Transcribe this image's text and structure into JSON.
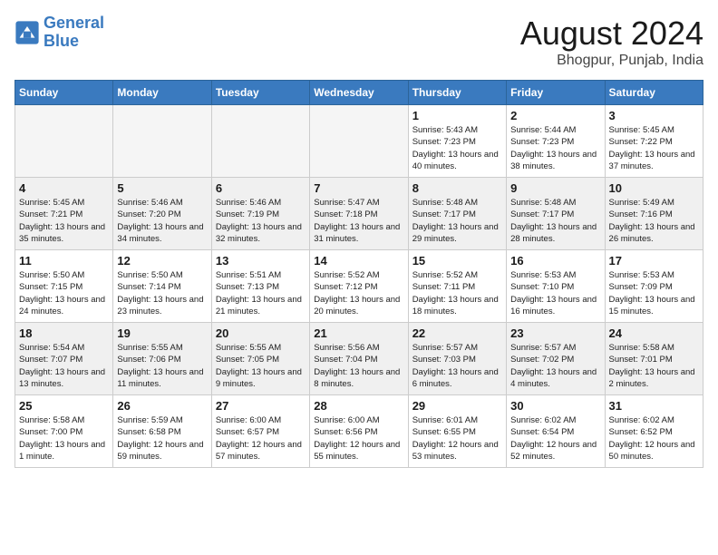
{
  "header": {
    "logo_line1": "General",
    "logo_line2": "Blue",
    "month_title": "August 2024",
    "location": "Bhogpur, Punjab, India"
  },
  "weekdays": [
    "Sunday",
    "Monday",
    "Tuesday",
    "Wednesday",
    "Thursday",
    "Friday",
    "Saturday"
  ],
  "weeks": [
    [
      {
        "day": "",
        "empty": true
      },
      {
        "day": "",
        "empty": true
      },
      {
        "day": "",
        "empty": true
      },
      {
        "day": "",
        "empty": true
      },
      {
        "day": "1",
        "sunrise": "5:43 AM",
        "sunset": "7:23 PM",
        "daylight": "13 hours and 40 minutes."
      },
      {
        "day": "2",
        "sunrise": "5:44 AM",
        "sunset": "7:23 PM",
        "daylight": "13 hours and 38 minutes."
      },
      {
        "day": "3",
        "sunrise": "5:45 AM",
        "sunset": "7:22 PM",
        "daylight": "13 hours and 37 minutes."
      }
    ],
    [
      {
        "day": "4",
        "sunrise": "5:45 AM",
        "sunset": "7:21 PM",
        "daylight": "13 hours and 35 minutes."
      },
      {
        "day": "5",
        "sunrise": "5:46 AM",
        "sunset": "7:20 PM",
        "daylight": "13 hours and 34 minutes."
      },
      {
        "day": "6",
        "sunrise": "5:46 AM",
        "sunset": "7:19 PM",
        "daylight": "13 hours and 32 minutes."
      },
      {
        "day": "7",
        "sunrise": "5:47 AM",
        "sunset": "7:18 PM",
        "daylight": "13 hours and 31 minutes."
      },
      {
        "day": "8",
        "sunrise": "5:48 AM",
        "sunset": "7:17 PM",
        "daylight": "13 hours and 29 minutes."
      },
      {
        "day": "9",
        "sunrise": "5:48 AM",
        "sunset": "7:17 PM",
        "daylight": "13 hours and 28 minutes."
      },
      {
        "day": "10",
        "sunrise": "5:49 AM",
        "sunset": "7:16 PM",
        "daylight": "13 hours and 26 minutes."
      }
    ],
    [
      {
        "day": "11",
        "sunrise": "5:50 AM",
        "sunset": "7:15 PM",
        "daylight": "13 hours and 24 minutes."
      },
      {
        "day": "12",
        "sunrise": "5:50 AM",
        "sunset": "7:14 PM",
        "daylight": "13 hours and 23 minutes."
      },
      {
        "day": "13",
        "sunrise": "5:51 AM",
        "sunset": "7:13 PM",
        "daylight": "13 hours and 21 minutes."
      },
      {
        "day": "14",
        "sunrise": "5:52 AM",
        "sunset": "7:12 PM",
        "daylight": "13 hours and 20 minutes."
      },
      {
        "day": "15",
        "sunrise": "5:52 AM",
        "sunset": "7:11 PM",
        "daylight": "13 hours and 18 minutes."
      },
      {
        "day": "16",
        "sunrise": "5:53 AM",
        "sunset": "7:10 PM",
        "daylight": "13 hours and 16 minutes."
      },
      {
        "day": "17",
        "sunrise": "5:53 AM",
        "sunset": "7:09 PM",
        "daylight": "13 hours and 15 minutes."
      }
    ],
    [
      {
        "day": "18",
        "sunrise": "5:54 AM",
        "sunset": "7:07 PM",
        "daylight": "13 hours and 13 minutes."
      },
      {
        "day": "19",
        "sunrise": "5:55 AM",
        "sunset": "7:06 PM",
        "daylight": "13 hours and 11 minutes."
      },
      {
        "day": "20",
        "sunrise": "5:55 AM",
        "sunset": "7:05 PM",
        "daylight": "13 hours and 9 minutes."
      },
      {
        "day": "21",
        "sunrise": "5:56 AM",
        "sunset": "7:04 PM",
        "daylight": "13 hours and 8 minutes."
      },
      {
        "day": "22",
        "sunrise": "5:57 AM",
        "sunset": "7:03 PM",
        "daylight": "13 hours and 6 minutes."
      },
      {
        "day": "23",
        "sunrise": "5:57 AM",
        "sunset": "7:02 PM",
        "daylight": "13 hours and 4 minutes."
      },
      {
        "day": "24",
        "sunrise": "5:58 AM",
        "sunset": "7:01 PM",
        "daylight": "13 hours and 2 minutes."
      }
    ],
    [
      {
        "day": "25",
        "sunrise": "5:58 AM",
        "sunset": "7:00 PM",
        "daylight": "13 hours and 1 minute."
      },
      {
        "day": "26",
        "sunrise": "5:59 AM",
        "sunset": "6:58 PM",
        "daylight": "12 hours and 59 minutes."
      },
      {
        "day": "27",
        "sunrise": "6:00 AM",
        "sunset": "6:57 PM",
        "daylight": "12 hours and 57 minutes."
      },
      {
        "day": "28",
        "sunrise": "6:00 AM",
        "sunset": "6:56 PM",
        "daylight": "12 hours and 55 minutes."
      },
      {
        "day": "29",
        "sunrise": "6:01 AM",
        "sunset": "6:55 PM",
        "daylight": "12 hours and 53 minutes."
      },
      {
        "day": "30",
        "sunrise": "6:02 AM",
        "sunset": "6:54 PM",
        "daylight": "12 hours and 52 minutes."
      },
      {
        "day": "31",
        "sunrise": "6:02 AM",
        "sunset": "6:52 PM",
        "daylight": "12 hours and 50 minutes."
      }
    ]
  ]
}
